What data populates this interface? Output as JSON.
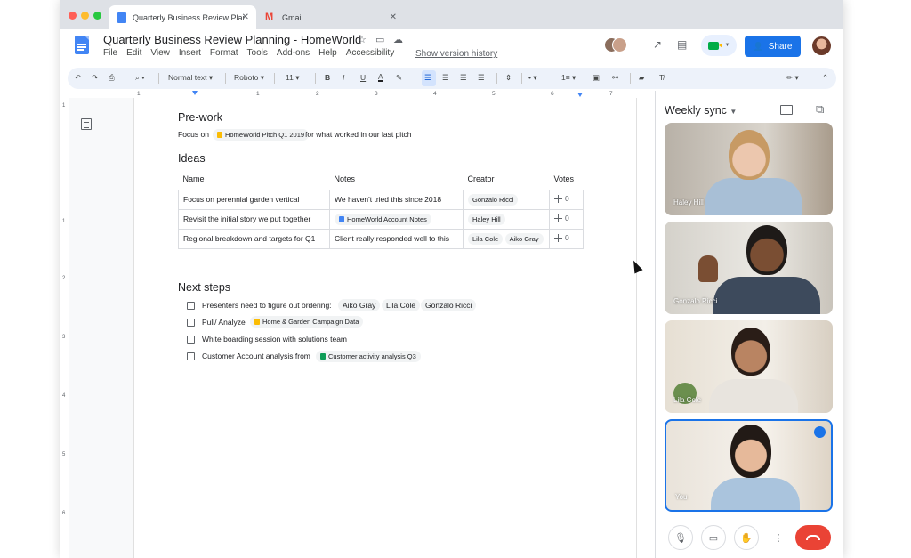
{
  "browser": {
    "tabs": [
      {
        "label": "Quarterly Business Review Plan",
        "icon": "docs-icon",
        "active": true
      },
      {
        "label": "Gmail",
        "icon": "gmail-icon",
        "active": false
      }
    ]
  },
  "doc": {
    "title": "Quarterly Business Review Planning - HomeWorld",
    "menus": [
      "File",
      "Edit",
      "View",
      "Insert",
      "Format",
      "Tools",
      "Add-ons",
      "Help",
      "Accessibility"
    ],
    "version_history": "Show version history",
    "share_label": "Share"
  },
  "toolbar": {
    "style": "Normal text",
    "font": "Roboto",
    "size": "11"
  },
  "ruler": [
    "1",
    "1",
    "2",
    "3",
    "4",
    "5",
    "6",
    "7"
  ],
  "vruler": [
    "1",
    "1",
    "2",
    "3",
    "4",
    "5",
    "6"
  ],
  "content": {
    "prework": {
      "heading": "Pre-work",
      "prefix": "Focus on",
      "chip": "HomeWorld Pitch Q1 2019",
      "suffix": "for what worked in our last pitch"
    },
    "ideas": {
      "heading": "Ideas",
      "headers": [
        "Name",
        "Notes",
        "Creator",
        "Votes"
      ],
      "rows": [
        {
          "name": "Focus on perennial garden vertical",
          "notes": "We haven't tried this since 2018",
          "creator": [
            "Gonzalo Ricci"
          ],
          "votes": "0"
        },
        {
          "name": "Revisit the initial story we put together",
          "notes": "HomeWorld Account Notes",
          "creator": [
            "Haley Hill"
          ],
          "votes": "0"
        },
        {
          "name": "Regional breakdown and targets for Q1",
          "notes": "Client really responded well to this",
          "creator": [
            "Lila Cole",
            "Aiko Gray"
          ],
          "votes": "0"
        }
      ]
    },
    "nextsteps": {
      "heading": "Next steps",
      "items": [
        {
          "text": "Presenters need to figure out ordering:",
          "people": [
            "Aiko Gray",
            "Lila Cole",
            "Gonzalo Ricci"
          ]
        },
        {
          "text": "Pull/ Analyze",
          "chip": "Home & Garden Campaign Data"
        },
        {
          "text": "White boarding session with solutions team"
        },
        {
          "text": "Customer Account analysis from",
          "chip": "Customer activity analysis Q3"
        }
      ]
    }
  },
  "meet": {
    "title": "Weekly sync",
    "participants": [
      "Haley Hill",
      "Gonzalo Ricci",
      "Lila Cole",
      "You"
    ]
  },
  "colors": {
    "accent": "#1a73e8",
    "end_call": "#ea4335"
  }
}
